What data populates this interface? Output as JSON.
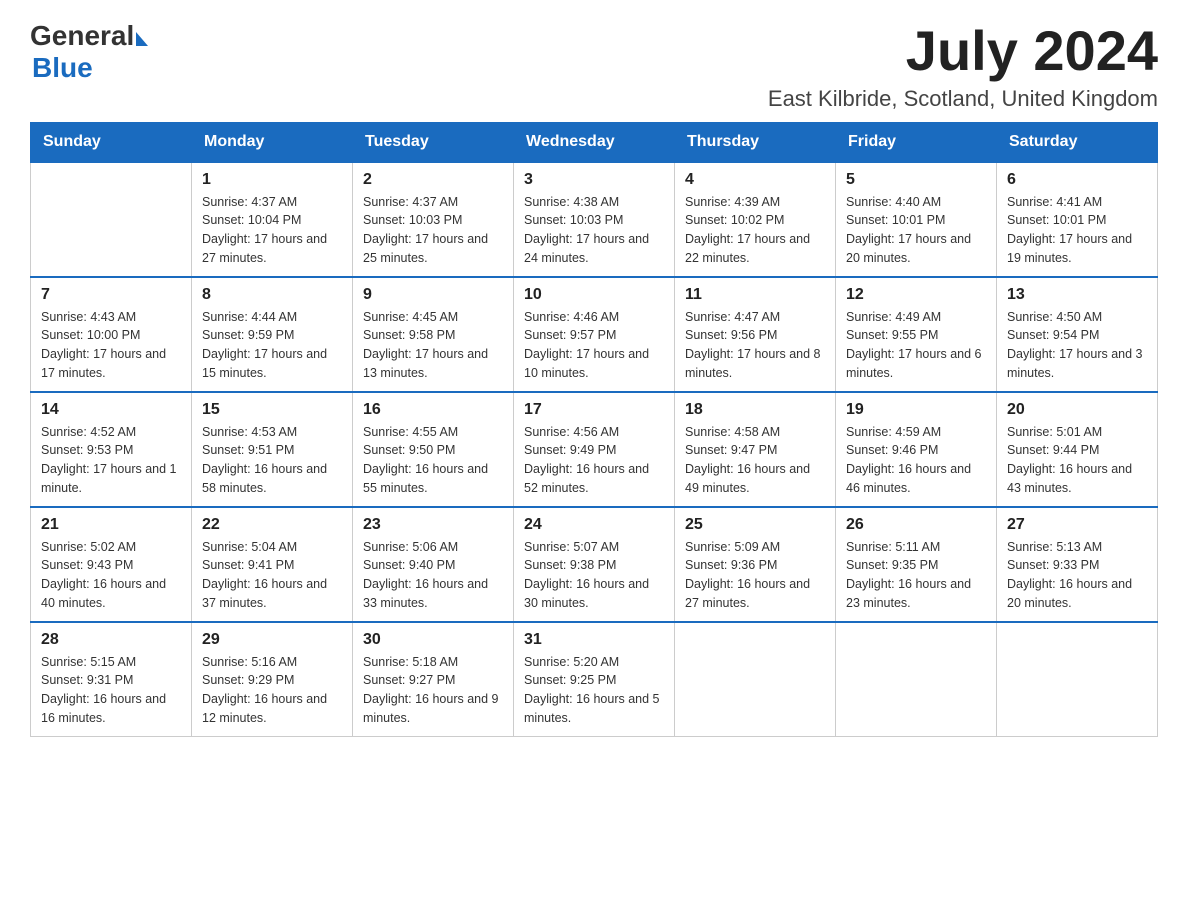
{
  "logo": {
    "general": "General",
    "blue": "Blue"
  },
  "title": "July 2024",
  "location": "East Kilbride, Scotland, United Kingdom",
  "days_of_week": [
    "Sunday",
    "Monday",
    "Tuesday",
    "Wednesday",
    "Thursday",
    "Friday",
    "Saturday"
  ],
  "weeks": [
    [
      {
        "day": "",
        "sunrise": "",
        "sunset": "",
        "daylight": ""
      },
      {
        "day": "1",
        "sunrise": "Sunrise: 4:37 AM",
        "sunset": "Sunset: 10:04 PM",
        "daylight": "Daylight: 17 hours and 27 minutes."
      },
      {
        "day": "2",
        "sunrise": "Sunrise: 4:37 AM",
        "sunset": "Sunset: 10:03 PM",
        "daylight": "Daylight: 17 hours and 25 minutes."
      },
      {
        "day": "3",
        "sunrise": "Sunrise: 4:38 AM",
        "sunset": "Sunset: 10:03 PM",
        "daylight": "Daylight: 17 hours and 24 minutes."
      },
      {
        "day": "4",
        "sunrise": "Sunrise: 4:39 AM",
        "sunset": "Sunset: 10:02 PM",
        "daylight": "Daylight: 17 hours and 22 minutes."
      },
      {
        "day": "5",
        "sunrise": "Sunrise: 4:40 AM",
        "sunset": "Sunset: 10:01 PM",
        "daylight": "Daylight: 17 hours and 20 minutes."
      },
      {
        "day": "6",
        "sunrise": "Sunrise: 4:41 AM",
        "sunset": "Sunset: 10:01 PM",
        "daylight": "Daylight: 17 hours and 19 minutes."
      }
    ],
    [
      {
        "day": "7",
        "sunrise": "Sunrise: 4:43 AM",
        "sunset": "Sunset: 10:00 PM",
        "daylight": "Daylight: 17 hours and 17 minutes."
      },
      {
        "day": "8",
        "sunrise": "Sunrise: 4:44 AM",
        "sunset": "Sunset: 9:59 PM",
        "daylight": "Daylight: 17 hours and 15 minutes."
      },
      {
        "day": "9",
        "sunrise": "Sunrise: 4:45 AM",
        "sunset": "Sunset: 9:58 PM",
        "daylight": "Daylight: 17 hours and 13 minutes."
      },
      {
        "day": "10",
        "sunrise": "Sunrise: 4:46 AM",
        "sunset": "Sunset: 9:57 PM",
        "daylight": "Daylight: 17 hours and 10 minutes."
      },
      {
        "day": "11",
        "sunrise": "Sunrise: 4:47 AM",
        "sunset": "Sunset: 9:56 PM",
        "daylight": "Daylight: 17 hours and 8 minutes."
      },
      {
        "day": "12",
        "sunrise": "Sunrise: 4:49 AM",
        "sunset": "Sunset: 9:55 PM",
        "daylight": "Daylight: 17 hours and 6 minutes."
      },
      {
        "day": "13",
        "sunrise": "Sunrise: 4:50 AM",
        "sunset": "Sunset: 9:54 PM",
        "daylight": "Daylight: 17 hours and 3 minutes."
      }
    ],
    [
      {
        "day": "14",
        "sunrise": "Sunrise: 4:52 AM",
        "sunset": "Sunset: 9:53 PM",
        "daylight": "Daylight: 17 hours and 1 minute."
      },
      {
        "day": "15",
        "sunrise": "Sunrise: 4:53 AM",
        "sunset": "Sunset: 9:51 PM",
        "daylight": "Daylight: 16 hours and 58 minutes."
      },
      {
        "day": "16",
        "sunrise": "Sunrise: 4:55 AM",
        "sunset": "Sunset: 9:50 PM",
        "daylight": "Daylight: 16 hours and 55 minutes."
      },
      {
        "day": "17",
        "sunrise": "Sunrise: 4:56 AM",
        "sunset": "Sunset: 9:49 PM",
        "daylight": "Daylight: 16 hours and 52 minutes."
      },
      {
        "day": "18",
        "sunrise": "Sunrise: 4:58 AM",
        "sunset": "Sunset: 9:47 PM",
        "daylight": "Daylight: 16 hours and 49 minutes."
      },
      {
        "day": "19",
        "sunrise": "Sunrise: 4:59 AM",
        "sunset": "Sunset: 9:46 PM",
        "daylight": "Daylight: 16 hours and 46 minutes."
      },
      {
        "day": "20",
        "sunrise": "Sunrise: 5:01 AM",
        "sunset": "Sunset: 9:44 PM",
        "daylight": "Daylight: 16 hours and 43 minutes."
      }
    ],
    [
      {
        "day": "21",
        "sunrise": "Sunrise: 5:02 AM",
        "sunset": "Sunset: 9:43 PM",
        "daylight": "Daylight: 16 hours and 40 minutes."
      },
      {
        "day": "22",
        "sunrise": "Sunrise: 5:04 AM",
        "sunset": "Sunset: 9:41 PM",
        "daylight": "Daylight: 16 hours and 37 minutes."
      },
      {
        "day": "23",
        "sunrise": "Sunrise: 5:06 AM",
        "sunset": "Sunset: 9:40 PM",
        "daylight": "Daylight: 16 hours and 33 minutes."
      },
      {
        "day": "24",
        "sunrise": "Sunrise: 5:07 AM",
        "sunset": "Sunset: 9:38 PM",
        "daylight": "Daylight: 16 hours and 30 minutes."
      },
      {
        "day": "25",
        "sunrise": "Sunrise: 5:09 AM",
        "sunset": "Sunset: 9:36 PM",
        "daylight": "Daylight: 16 hours and 27 minutes."
      },
      {
        "day": "26",
        "sunrise": "Sunrise: 5:11 AM",
        "sunset": "Sunset: 9:35 PM",
        "daylight": "Daylight: 16 hours and 23 minutes."
      },
      {
        "day": "27",
        "sunrise": "Sunrise: 5:13 AM",
        "sunset": "Sunset: 9:33 PM",
        "daylight": "Daylight: 16 hours and 20 minutes."
      }
    ],
    [
      {
        "day": "28",
        "sunrise": "Sunrise: 5:15 AM",
        "sunset": "Sunset: 9:31 PM",
        "daylight": "Daylight: 16 hours and 16 minutes."
      },
      {
        "day": "29",
        "sunrise": "Sunrise: 5:16 AM",
        "sunset": "Sunset: 9:29 PM",
        "daylight": "Daylight: 16 hours and 12 minutes."
      },
      {
        "day": "30",
        "sunrise": "Sunrise: 5:18 AM",
        "sunset": "Sunset: 9:27 PM",
        "daylight": "Daylight: 16 hours and 9 minutes."
      },
      {
        "day": "31",
        "sunrise": "Sunrise: 5:20 AM",
        "sunset": "Sunset: 9:25 PM",
        "daylight": "Daylight: 16 hours and 5 minutes."
      },
      {
        "day": "",
        "sunrise": "",
        "sunset": "",
        "daylight": ""
      },
      {
        "day": "",
        "sunrise": "",
        "sunset": "",
        "daylight": ""
      },
      {
        "day": "",
        "sunrise": "",
        "sunset": "",
        "daylight": ""
      }
    ]
  ]
}
